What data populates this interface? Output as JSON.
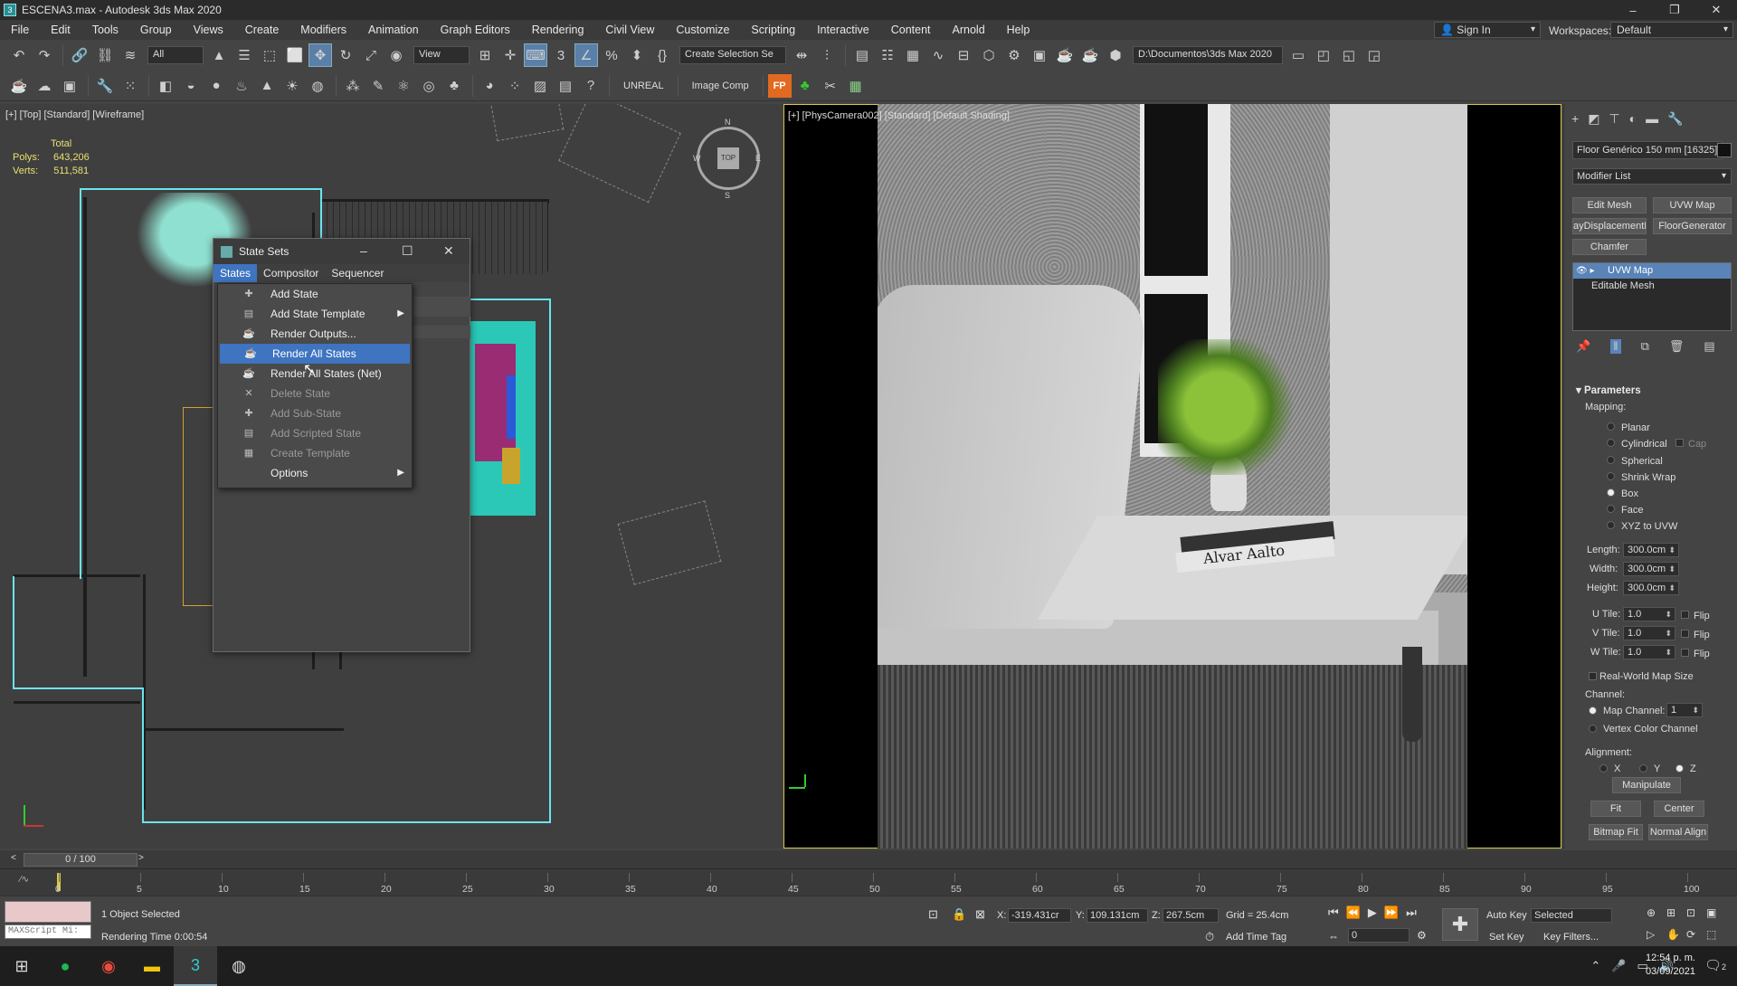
{
  "window": {
    "title": "ESCENA3.max - Autodesk 3ds Max 2020",
    "min": "–",
    "max": "❐",
    "close": "✕"
  },
  "menu": [
    "File",
    "Edit",
    "Tools",
    "Group",
    "Views",
    "Create",
    "Modifiers",
    "Animation",
    "Graph Editors",
    "Rendering",
    "Civil View",
    "Customize",
    "Scripting",
    "Interactive",
    "Content",
    "Arnold",
    "Help"
  ],
  "account": {
    "signin": "Sign In",
    "workspaces_label": "Workspaces:",
    "workspace": "Default"
  },
  "toolbar": {
    "filter": "All",
    "ref_coord": "View",
    "selection_set": "Create Selection Se",
    "path": "D:\\Documentos\\3ds Max 2020",
    "unreal": "UNREAL",
    "image_comp": "Image Comp",
    "fp": "FP"
  },
  "viewport_left": {
    "label": "[+] [Top] [Standard] [Wireframe]",
    "stats": {
      "total": "Total",
      "polys_label": "Polys:",
      "polys": "643,206",
      "verts_label": "Verts:",
      "verts": "511,581"
    },
    "viewcube": "TOP",
    "compass": {
      "n": "N",
      "s": "S",
      "e": "E",
      "w": "W"
    }
  },
  "viewport_right": {
    "label": "[+] [PhysCamera002] [Standard] [Default Shading]",
    "book_text": "Alvar Aalto"
  },
  "state_sets": {
    "title": "State Sets",
    "menu": [
      "States",
      "Compositor",
      "Sequencer"
    ],
    "items": [
      {
        "label": "Add State",
        "icon": "add-state-icon",
        "enabled": true
      },
      {
        "label": "Add State Template",
        "icon": "template-icon",
        "enabled": true,
        "submenu": true
      },
      {
        "label": "Render Outputs...",
        "icon": "render-outputs-icon",
        "enabled": true
      },
      {
        "label": "Render All States",
        "icon": "teapot-icon",
        "enabled": true,
        "highlighted": true
      },
      {
        "label": "Render All States (Net)",
        "icon": "teapot-net-icon",
        "enabled": true
      },
      {
        "label": "Delete State",
        "icon": "delete-icon",
        "enabled": false
      },
      {
        "label": "Add Sub-State",
        "icon": "sub-state-icon",
        "enabled": false
      },
      {
        "label": "Add Scripted State",
        "icon": "script-icon",
        "enabled": false
      },
      {
        "label": "Create Template",
        "icon": "create-template-icon",
        "enabled": false
      },
      {
        "label": "Options",
        "icon": "",
        "enabled": true,
        "submenu": true
      }
    ]
  },
  "command_panel": {
    "object_name": "Floor Genérico 150 mm [16325]",
    "modifier_list": "Modifier List",
    "buttons": [
      "Edit Mesh",
      "UVW Map",
      "ayDisplacementM",
      "FloorGenerator",
      "Chamfer"
    ],
    "stack": [
      "UVW Map",
      "Editable Mesh"
    ],
    "parameters": {
      "title": "Parameters",
      "mapping_label": "Mapping:",
      "mapping": [
        "Planar",
        "Cylindrical",
        "Spherical",
        "Shrink Wrap",
        "Box",
        "Face",
        "XYZ to UVW"
      ],
      "selected_mapping": "Box",
      "cap": "Cap",
      "length_label": "Length:",
      "length": "300.0cm",
      "width_label": "Width:",
      "width": "300.0cm",
      "height_label": "Height:",
      "height": "300.0cm",
      "utile_label": "U Tile:",
      "utile": "1.0",
      "vtile_label": "V Tile:",
      "vtile": "1.0",
      "wtile_label": "W Tile:",
      "wtile": "1.0",
      "flip": "Flip",
      "real_world": "Real-World Map Size",
      "channel_label": "Channel:",
      "map_channel_label": "Map Channel:",
      "map_channel": "1",
      "vertex_color": "Vertex Color Channel",
      "alignment_label": "Alignment:",
      "axes": [
        "X",
        "Y",
        "Z"
      ],
      "selected_axis": "Z",
      "manipulate": "Manipulate",
      "fit": "Fit",
      "center": "Center",
      "bitmap_fit": "Bitmap Fit",
      "normal_align": "Normal Align"
    }
  },
  "timeline": {
    "frame": "0 / 100",
    "ticks": [
      "0",
      "5",
      "10",
      "15",
      "20",
      "25",
      "30",
      "35",
      "40",
      "45",
      "50",
      "55",
      "60",
      "65",
      "70",
      "75",
      "80",
      "85",
      "90",
      "95",
      "100"
    ]
  },
  "status": {
    "maxscript": "MAXScript Mi:",
    "selection": "1 Object Selected",
    "rendering": "Rendering Time  0:00:54",
    "x_label": "X:",
    "x": "-319.431cr",
    "y_label": "Y:",
    "y": "109.131cm",
    "z_label": "Z:",
    "z": "267.5cm",
    "grid": "Grid = 25.4cm",
    "add_time_tag": "Add Time Tag",
    "auto_key": "Auto Key",
    "set_key": "Set Key",
    "selected": "Selected",
    "key_filters": "Key Filters...",
    "frame_field": "0"
  },
  "taskbar": {
    "time": "12:54 p. m.",
    "date": "03/09/2021",
    "notif_count": "2"
  }
}
